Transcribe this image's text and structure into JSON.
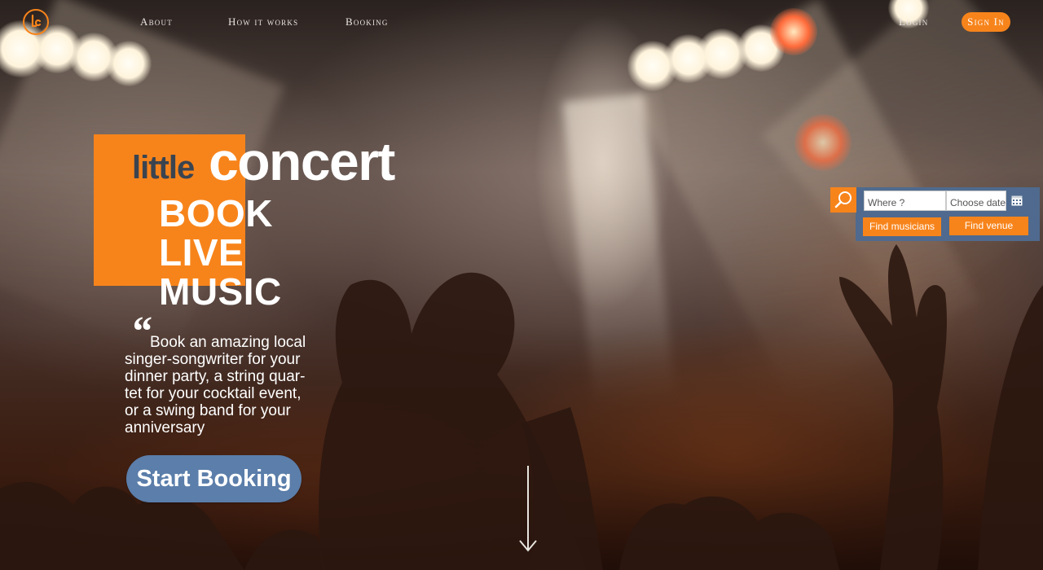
{
  "nav": {
    "about": "About",
    "how_it_works": "How it works",
    "booking": "Booking",
    "login": "Login",
    "sign_in": "Sign In"
  },
  "brand": {
    "logo_icon": "lc-logo-icon",
    "little": "little",
    "concert": "concert",
    "accent_color": "#f7841b"
  },
  "hero": {
    "headline": [
      "BOOK",
      "LIVE",
      "MUSIC"
    ],
    "quote_mark": "“",
    "blurb_lines": [
      "Book an amazing local",
      "singer-songwriter for your",
      "dinner party, a string quar-",
      "tet for your cocktail event,",
      "or a swing band for your",
      "anniversary"
    ],
    "cta": "Start Booking",
    "cta_color": "#5b7eaa"
  },
  "search": {
    "icon": "search-icon",
    "where_placeholder": "Where ?",
    "date_placeholder": "Choose date",
    "calendar_icon": "calendar-icon",
    "find_musicians": "Find musicians",
    "find_venue": "Find venue",
    "panel_color": "#4f6a8e"
  },
  "scroll_indicator": "arrow-down-icon"
}
